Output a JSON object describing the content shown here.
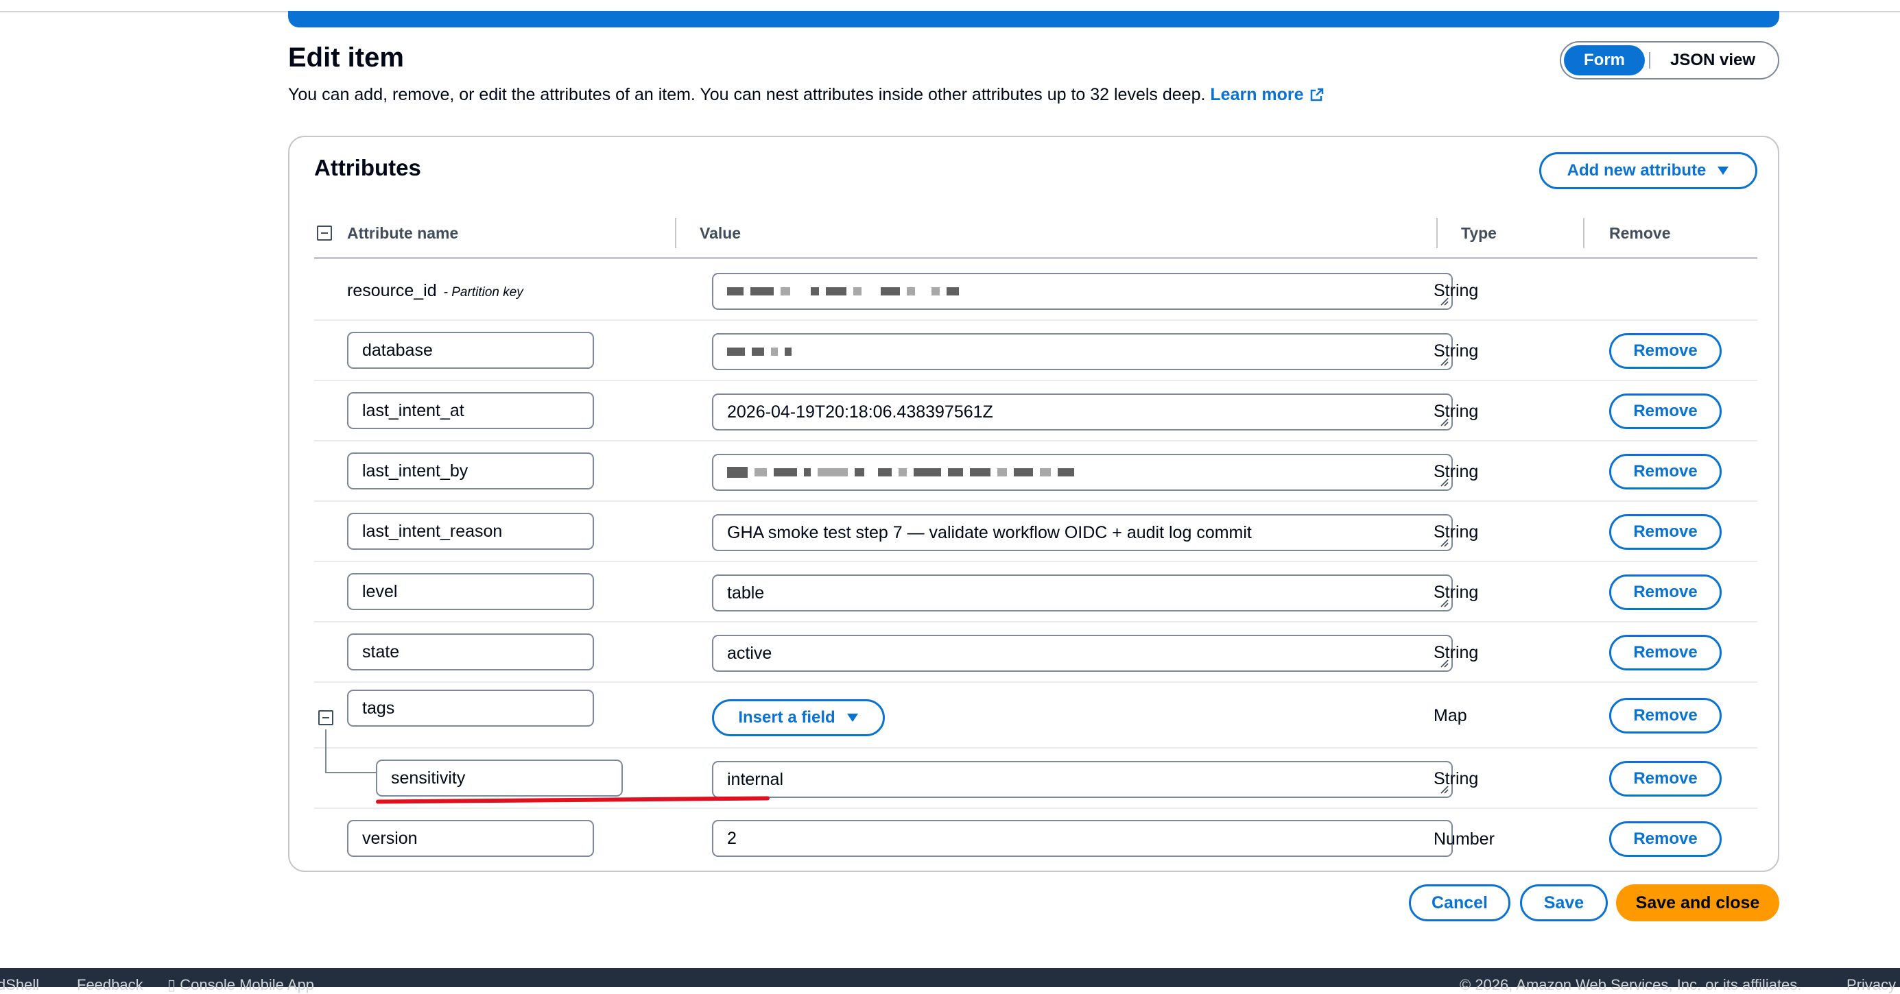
{
  "page": {
    "title": "Edit item",
    "description": "You can add, remove, or edit the attributes of an item. You can nest attributes inside other attributes up to 32 levels deep.",
    "learn_more": "Learn more"
  },
  "view_toggle": {
    "form": "Form",
    "json": "JSON view",
    "selected": "Form"
  },
  "attributes": {
    "title": "Attributes",
    "add_new": "Add new attribute",
    "headers": {
      "name": "Attribute name",
      "value": "Value",
      "type": "Type",
      "remove": "Remove"
    },
    "partition_key_label": "- Partition key",
    "remove_label": "Remove",
    "insert_field_label": "Insert a field",
    "rows": [
      {
        "name": "resource_id",
        "value": "",
        "type": "String"
      },
      {
        "name": "database",
        "value": "",
        "type": "String"
      },
      {
        "name": "last_intent_at",
        "value": "2026-04-19T20:18:06.438397561Z",
        "type": "String"
      },
      {
        "name": "last_intent_by",
        "value": "",
        "type": "String"
      },
      {
        "name": "last_intent_reason",
        "value": "GHA smoke test step 7 — validate workflow OIDC + audit log commit",
        "type": "String"
      },
      {
        "name": "level",
        "value": "table",
        "type": "String"
      },
      {
        "name": "state",
        "value": "active",
        "type": "String"
      },
      {
        "name": "tags",
        "value": "",
        "type": "Map"
      },
      {
        "name": "sensitivity",
        "value": "internal",
        "type": "String"
      },
      {
        "name": "version",
        "value": "2",
        "type": "Number"
      }
    ]
  },
  "actions": {
    "cancel": "Cancel",
    "save": "Save",
    "save_close": "Save and close"
  },
  "footer": {
    "cloudshell": "dShell",
    "feedback": "Feedback",
    "mobile_app": "Console Mobile App",
    "copyright": "© 2026, Amazon Web Services, Inc. or its affiliates.",
    "privacy": "Privacy"
  },
  "colors": {
    "accent": "#0972d3",
    "primary_button": "#ff9900",
    "annotation": "#e0101e",
    "footer_bg": "#232f3e"
  }
}
